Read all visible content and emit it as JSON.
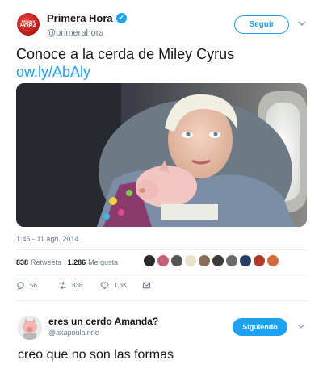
{
  "tweet": {
    "author": {
      "brand_line1": "Primera",
      "brand_line2": "HORA",
      "name": "Primera Hora",
      "handle": "@primerahora",
      "verified": true
    },
    "follow_label": "Seguir",
    "text": "Conoce a la cerda de Miley Cyrus ",
    "link_text": "ow.ly/AbAly",
    "timestamp": "1:45 - 11 ago. 2014",
    "stats": {
      "retweets_count": "838",
      "retweets_label": "Retweets",
      "likes_count": "1.286",
      "likes_label": "Me gusta"
    },
    "actions": {
      "replies": "56",
      "retweets": "838",
      "likes": "1,3K"
    },
    "liker_colors": [
      "#2b2b2b",
      "#c0607a",
      "#555555",
      "#e8e2c8",
      "#8a6e5a",
      "#3a3a3a",
      "#6b6b6b",
      "#2a3f66",
      "#b23a2a",
      "#d46a3a"
    ]
  },
  "reply": {
    "name": "eres un cerdo Amanda?",
    "handle": "@akapoulainne",
    "following_label": "Siguiendo",
    "text": "creo que no son las formas"
  },
  "icons": {
    "verified": "verified-badge-icon",
    "chevron": "chevron-down-icon",
    "reply": "reply-icon",
    "retweet": "retweet-icon",
    "like": "heart-icon",
    "dm": "envelope-icon"
  },
  "colors": {
    "accent": "#1da1f2",
    "text": "#14171a",
    "muted": "#657786",
    "brand": "#c41e22"
  }
}
